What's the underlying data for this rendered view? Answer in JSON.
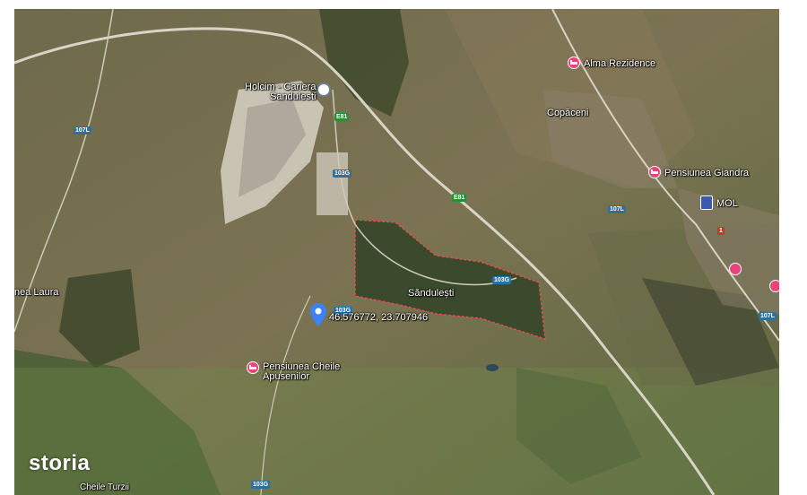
{
  "map": {
    "type": "satellite",
    "places": {
      "holcim": "Holcim - Cariera\nSandulesti",
      "alma": "Alma Rezidence",
      "copaceni": "Copăceni",
      "giandra": "Pensiunea Giandra",
      "mol": "MOL",
      "laura": "nea Laura",
      "sandulesti": "Săndulești",
      "cheile_apusenilor": "Pensiunea Cheile\nApusenilor",
      "cheile_turzii": "Cheile Turzii"
    },
    "coordinates": "46.576772, 23.707946",
    "road_shields": {
      "r107l_a": "107L",
      "r107l_b": "107L",
      "r107l_c": "107L",
      "e81_a": "E81",
      "e81_b": "E81",
      "r103g_a": "103G",
      "r103g_b": "103G",
      "r103g_c": "103G",
      "r103g_d": "103G",
      "r1": "1"
    },
    "colors": {
      "boundary": "#e05050",
      "pin_blue": "#3b82f6",
      "poi_pink": "#e8447c",
      "road_shield": "#2f6f9b",
      "euro_shield": "#2e8b3a"
    }
  },
  "brand": {
    "logo_text": "storia"
  }
}
